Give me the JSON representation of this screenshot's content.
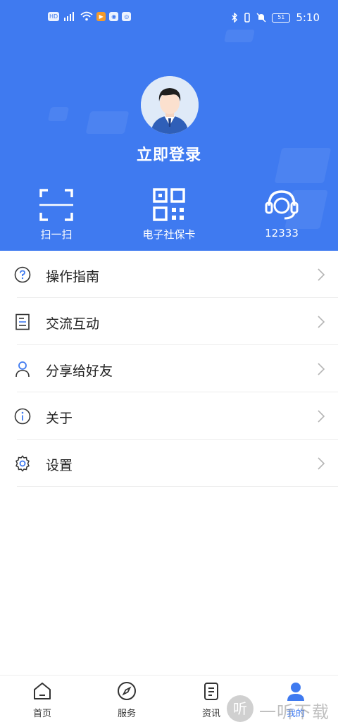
{
  "status_bar": {
    "left_chips": [
      "HD",
      "4G",
      "▶",
      "◉",
      "◎"
    ],
    "battery": "51",
    "time": "5:10"
  },
  "profile": {
    "login_label": "立即登录"
  },
  "quick_actions": [
    {
      "label": "扫一扫",
      "icon": "scan-icon"
    },
    {
      "label": "电子社保卡",
      "icon": "qr-code-icon"
    },
    {
      "label": "12333",
      "icon": "headset-icon"
    }
  ],
  "menu": [
    {
      "label": "操作指南",
      "icon": "question-circle-icon"
    },
    {
      "label": "交流互动",
      "icon": "document-icon"
    },
    {
      "label": "分享给好友",
      "icon": "user-icon"
    },
    {
      "label": "关于",
      "icon": "info-circle-icon"
    },
    {
      "label": "设置",
      "icon": "gear-icon"
    }
  ],
  "tabs": [
    {
      "label": "首页",
      "icon": "home-icon",
      "active": false
    },
    {
      "label": "服务",
      "icon": "compass-icon",
      "active": false
    },
    {
      "label": "资讯",
      "icon": "news-icon",
      "active": false
    },
    {
      "label": "我的",
      "icon": "profile-icon",
      "active": true
    }
  ],
  "watermark": {
    "logo": "听",
    "text": "一听下载"
  },
  "colors": {
    "primary": "#3f7af0",
    "text": "#222222",
    "divider": "#ececec"
  }
}
